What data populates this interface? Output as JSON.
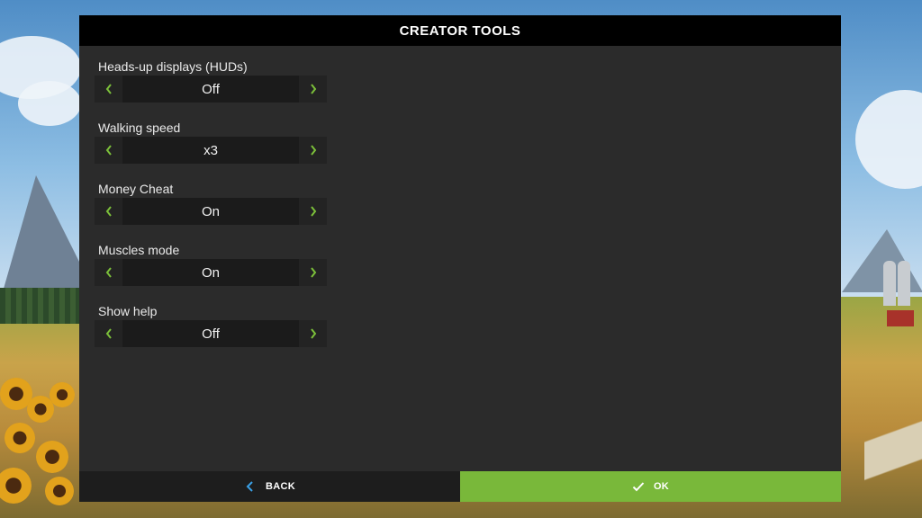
{
  "dialog": {
    "title": "CREATOR TOOLS"
  },
  "settings": [
    {
      "label": "Heads-up displays (HUDs)",
      "value": "Off"
    },
    {
      "label": "Walking speed",
      "value": "x3"
    },
    {
      "label": "Money Cheat",
      "value": "On"
    },
    {
      "label": "Muscles mode",
      "value": "On"
    },
    {
      "label": "Show help",
      "value": "Off"
    }
  ],
  "footer": {
    "back_label": "BACK",
    "ok_label": "OK"
  },
  "icons": {
    "prev": "chevron-left-icon",
    "next": "chevron-right-icon",
    "back": "chevron-left-icon",
    "ok": "checkmark-icon"
  },
  "colors": {
    "accent_green": "#79b83a",
    "arrow_green": "#7cc03a",
    "back_arrow_blue": "#3aa0e6",
    "header_bg": "#000000",
    "panel_bg": "#2b2b2b"
  }
}
